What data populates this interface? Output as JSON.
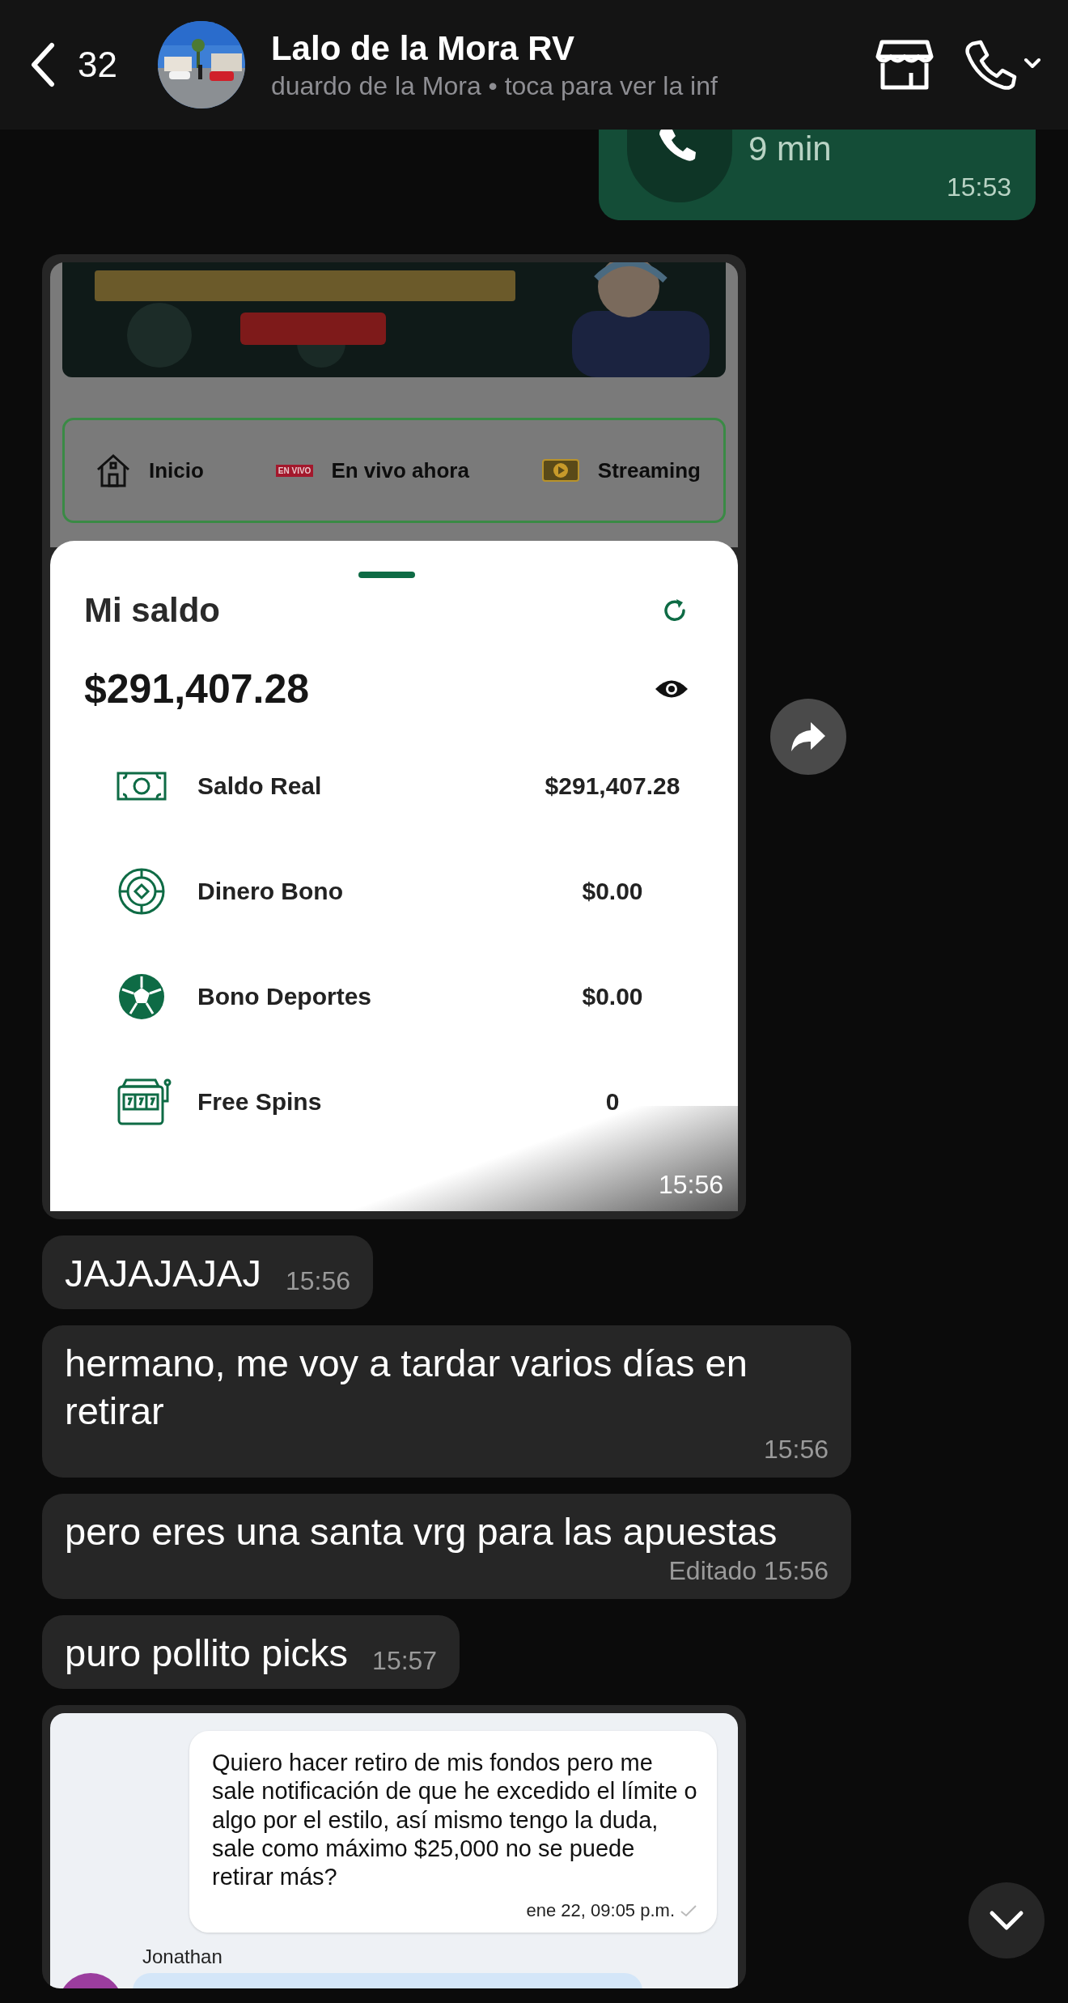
{
  "header": {
    "back_count": "32",
    "title": "Lalo de la Mora RV",
    "subtitle": "duardo de la Mora  • toca para ver la inf"
  },
  "messages": [
    {
      "kind": "call",
      "duration": "9 min",
      "time": "15:53"
    },
    {
      "kind": "balance_screenshot",
      "time": "15:56",
      "nav": [
        {
          "label": "Inicio"
        },
        {
          "label": "En vivo ahora",
          "badge": "EN VIVO"
        },
        {
          "label": "Streaming"
        }
      ],
      "sheet": {
        "title": "Mi saldo",
        "amount": "$291,407.28",
        "rows": [
          {
            "label": "Saldo Real",
            "value": "$291,407.28"
          },
          {
            "label": "Dinero Bono",
            "value": "$0.00"
          },
          {
            "label": "Bono Deportes",
            "value": "$0.00"
          },
          {
            "label": "Free Spins",
            "value": "0"
          }
        ]
      }
    },
    {
      "kind": "text",
      "text": "JAJAJAJAJ",
      "time": "15:56"
    },
    {
      "kind": "text",
      "text": "hermano, me voy a tardar varios días en retirar",
      "time": "15:56"
    },
    {
      "kind": "text",
      "text": "pero eres una santa vrg para las apuestas",
      "edited_label": "Editado",
      "time": "15:56"
    },
    {
      "kind": "text",
      "text": "puro pollito picks",
      "time": "15:57"
    },
    {
      "kind": "chat_screenshot",
      "message": "Quiero hacer retiro de mis fondos pero me sale notificación de que he excedido el límite o algo por el estilo, así mismo tengo la duda, sale como máximo $25,000 no se puede retirar más?",
      "message_time": "ene 22, 09:05 p.m.",
      "sender": "Jonathan"
    }
  ]
}
